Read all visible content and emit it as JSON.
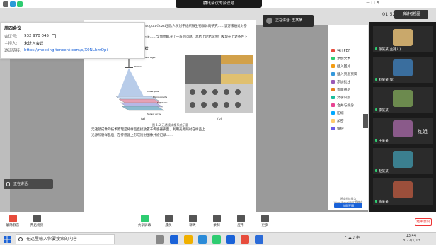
{
  "meeting": {
    "title": "腾讯会议的会议号",
    "duration": "01:52:01",
    "speaker_view": "演讲者视图",
    "notification": "正在讲话: 王某某"
  },
  "info_popup": {
    "title": "周四会议",
    "rows": [
      {
        "label": "会议号:",
        "value": "932 970 045"
      },
      {
        "label": "主持人:",
        "value": "未进入会议"
      },
      {
        "label": "邀请链接:",
        "value": "https://meeting.tencent.com/s/X0NLhmQpi"
      }
    ]
  },
  "document": {
    "para1": "在2004年西班牙迈发团(Gozzi)和Ayalogun Gozzi团队人员对于组织微生物群体的研究……该方法通过对参照",
    "para2": "计算成像技术作为一种新的光学成像方法……全面地解决了一系列问题。总结上述结论我们发现在上述条件下",
    "para3": "关于显微成像领域…（仿照参考文献）",
    "section": "1.2 无透镜成像技术国内外研究现状",
    "para4": "无透镜成像的技术原理是将样品直接放置于传感器表面，利用光源照射在样品上……",
    "figure_caption": "图 1.2 无透镜成像系统示意",
    "fig_labels": [
      "Monochromatic Light",
      "Pinhole",
      "Coverglass",
      "Micro-objects",
      "Substrate",
      "Sensor Array"
    ],
    "sublabel_a": "(a)",
    "sublabel_b": "(b)",
    "para5": "光源照射样品后，在传感器上形成衍射图像并被记录……"
  },
  "sidebar": {
    "tools": [
      "导出PDF",
      "添加文本",
      "插入图片",
      "插入页眉页脚",
      "添加批注",
      "页面组织",
      "文字识别",
      "合并与拆分",
      "压缩",
      "加密",
      "保护"
    ],
    "footer": "将文档转换为Word/Excel/PPT等格式",
    "cta": "立即开通"
  },
  "participants": [
    {
      "name": "张某某(主持人)",
      "color": "#c9a86b"
    },
    {
      "name": "刘某某(我)",
      "color": "#3a6e9e"
    },
    {
      "name": "李某某",
      "color": "#6c8a4e"
    },
    {
      "name": "王某某",
      "color": "#8a5a8a",
      "text": "红姐"
    },
    {
      "name": "赵某某",
      "color": "#3b7f8f"
    },
    {
      "name": "陈某某",
      "color": "#9b4f3b"
    }
  ],
  "toolbar": {
    "mute": "解除静音",
    "video": "开启视频",
    "share": "共享屏幕",
    "participants": "成员",
    "chat": "聊天",
    "record": "录制",
    "apps": "应用",
    "more": "更多",
    "end": "结束会议",
    "speaking": "正在讲话: "
  },
  "taskbar": {
    "search_placeholder": "在这里输入你要搜索的内容",
    "time": "13:44",
    "date": "2022/1/13",
    "ime": "中"
  }
}
